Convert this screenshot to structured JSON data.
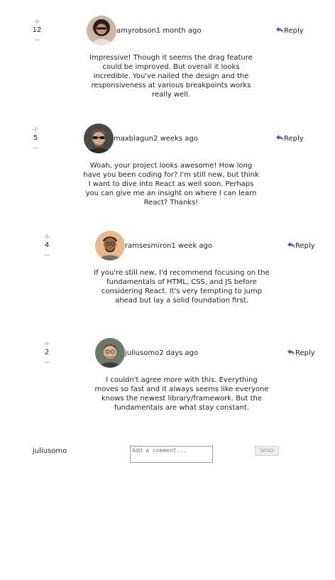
{
  "colors": {
    "vote_icon": "#c5c6ef",
    "reply_icon": "#5457b6"
  },
  "comments": [
    {
      "score": "12",
      "username": "amyrobson",
      "created_at": "1 month ago",
      "reply_label": "Reply",
      "avatar": "avatar-amyrobson",
      "content": "Impressive! Though it seems the drag feature could be improved. But overall it looks incredible. You've nailed the design and the responsiveness at various breakpoints works really well."
    },
    {
      "score": "5",
      "username": "maxblagun",
      "created_at": "2 weeks ago",
      "reply_label": "Reply",
      "avatar": "avatar-maxblagun",
      "content": "Woah, your project looks awesome! How long have you been coding for? I'm still new, but think I want to dive into React as well soon. Perhaps you can give me an insight on where I can learn React? Thanks!"
    },
    {
      "score": "4",
      "username": "ramsesmiron",
      "created_at": "1 week ago",
      "reply_label": "Reply",
      "avatar": "avatar-ramsesmiron",
      "content": "If you're still new, I'd recommend focusing on the fundamentals of HTML, CSS, and JS before considering React. It's very tempting to jump ahead but lay a solid foundation first."
    },
    {
      "score": "2",
      "username": "juliusomo",
      "created_at": "2 days ago",
      "reply_label": "Reply",
      "avatar": "avatar-juliusomo",
      "content": "I couldn't agree more with this. Everything moves so fast and it always seems like everyone knows the newest library/framework. But the fundamentals are what stay constant."
    }
  ],
  "composer": {
    "current_user": "juliusomo",
    "placeholder": "Add a comment...",
    "value": "",
    "send_label": "SEND"
  }
}
